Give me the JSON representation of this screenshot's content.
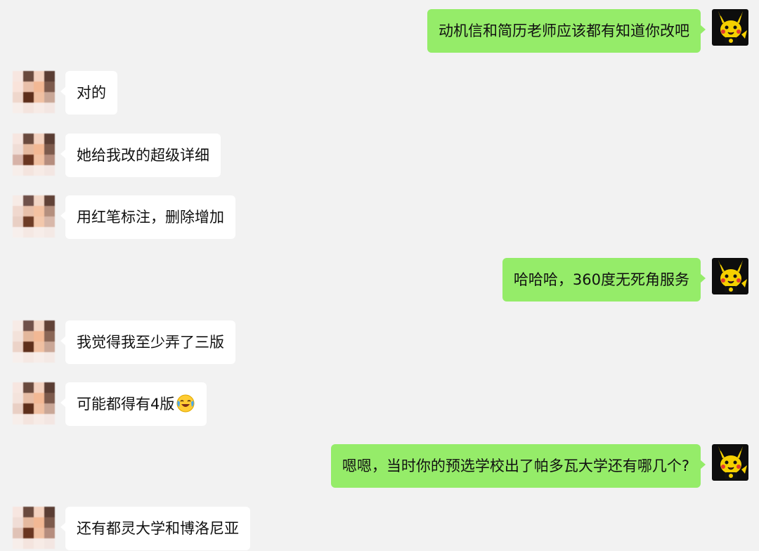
{
  "messages": [
    {
      "side": "right",
      "text": "动机信和简历老师应该都有知道你改吧"
    },
    {
      "side": "left",
      "text": "对的"
    },
    {
      "side": "left",
      "text": "她给我改的超级详细"
    },
    {
      "side": "left",
      "text": "用红笔标注，删除增加"
    },
    {
      "side": "right",
      "text": "哈哈哈，360度无死角服务"
    },
    {
      "side": "left",
      "text": "我觉得我至少弄了三版"
    },
    {
      "side": "left",
      "text": "可能都得有4版",
      "emoji": "laughing-crying-emoji"
    },
    {
      "side": "right",
      "text": "嗯嗯，当时你的预选学校出了帕多瓦大学还有哪几个?"
    },
    {
      "side": "left",
      "text": "还有都灵大学和博洛尼亚"
    }
  ],
  "colors": {
    "background": "#f2f2f2",
    "sent_bubble": "#95ec69",
    "received_bubble": "#ffffff"
  },
  "icons": {
    "own_avatar": "pikachu-avatar",
    "contact_avatar": "pixelated-avatar"
  }
}
